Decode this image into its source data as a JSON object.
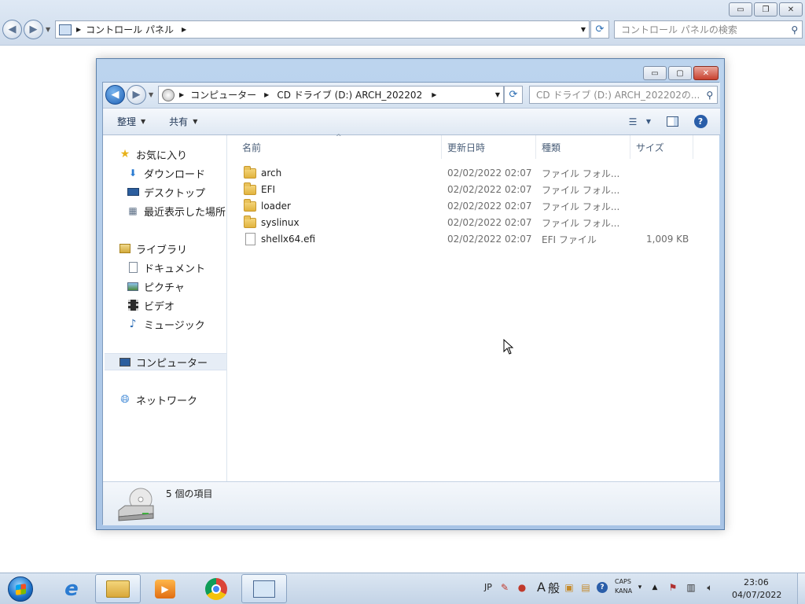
{
  "background_window": {
    "breadcrumb": [
      "コントロール パネル"
    ],
    "search_placeholder": "コントロール パネルの検索",
    "caption": {
      "minimize": "▭",
      "restore": "❐",
      "close": "✕"
    }
  },
  "explorer": {
    "breadcrumb": [
      "コンピューター",
      "CD ドライブ (D:) ARCH_202202"
    ],
    "search_placeholder": "CD ドライブ (D:) ARCH_202202の...",
    "toolbar": {
      "organize": "整理",
      "share": "共有"
    },
    "nav": {
      "favorites": {
        "label": "お気に入り",
        "items": [
          "ダウンロード",
          "デスクトップ",
          "最近表示した場所"
        ]
      },
      "libraries": {
        "label": "ライブラリ",
        "items": [
          "ドキュメント",
          "ピクチャ",
          "ビデオ",
          "ミュージック"
        ]
      },
      "computer": "コンピューター",
      "network": "ネットワーク"
    },
    "columns": {
      "name": "名前",
      "modified": "更新日時",
      "type": "種類",
      "size": "サイズ"
    },
    "files": [
      {
        "name": "arch",
        "modified": "02/02/2022 02:07",
        "type": "ファイル フォル...",
        "size": "",
        "kind": "folder"
      },
      {
        "name": "EFI",
        "modified": "02/02/2022 02:07",
        "type": "ファイル フォル...",
        "size": "",
        "kind": "folder"
      },
      {
        "name": "loader",
        "modified": "02/02/2022 02:07",
        "type": "ファイル フォル...",
        "size": "",
        "kind": "folder"
      },
      {
        "name": "syslinux",
        "modified": "02/02/2022 02:07",
        "type": "ファイル フォル...",
        "size": "",
        "kind": "folder"
      },
      {
        "name": "shellx64.efi",
        "modified": "02/02/2022 02:07",
        "type": "EFI ファイル",
        "size": "1,009 KB",
        "kind": "file"
      }
    ],
    "status": {
      "item_count": "5 個の項目"
    }
  },
  "taskbar": {
    "language": "JP",
    "ime_mode": "A",
    "ime_general": "般",
    "caps": "CAPS",
    "kana": "KANA",
    "clock_time": "23:06",
    "clock_date": "04/07/2022"
  }
}
